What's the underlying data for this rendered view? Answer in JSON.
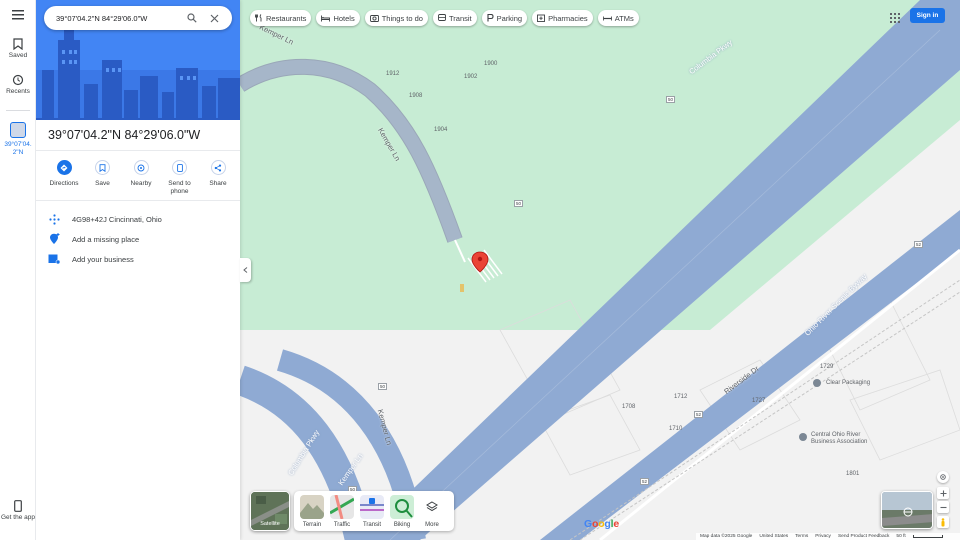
{
  "rail": {
    "saved_label": "Saved",
    "recents_label": "Recents",
    "recent_item_label": "39°07'04.\n2\"N",
    "get_app_label": "Get the app"
  },
  "search": {
    "value": "39°07'04.2\"N 84°29'06.0\"W"
  },
  "chips": [
    {
      "label": "Restaurants",
      "icon": "fork-knife-icon"
    },
    {
      "label": "Hotels",
      "icon": "bed-icon"
    },
    {
      "label": "Things to do",
      "icon": "camera-icon"
    },
    {
      "label": "Transit",
      "icon": "train-icon"
    },
    {
      "label": "Parking",
      "icon": "parking-icon"
    },
    {
      "label": "Pharmacies",
      "icon": "pharmacy-icon"
    },
    {
      "label": "ATMs",
      "icon": "atm-icon"
    }
  ],
  "header": {
    "sign_in_label": "Sign in"
  },
  "place": {
    "title": "39°07'04.2\"N 84°29'06.0\"W",
    "actions": [
      {
        "label": "Directions",
        "icon": "directions-icon"
      },
      {
        "label": "Save",
        "icon": "bookmark-icon"
      },
      {
        "label": "Nearby",
        "icon": "nearby-icon"
      },
      {
        "label": "Send to phone",
        "icon": "send-to-phone-icon"
      },
      {
        "label": "Share",
        "icon": "share-icon"
      }
    ],
    "plus_code": "4G98+42J Cincinnati, Ohio",
    "add_missing_place": "Add a missing place",
    "add_business": "Add your business"
  },
  "map": {
    "roads": {
      "columbia_pkwy_top": "Columbia Pkwy",
      "columbia_pkwy_bottom": "Columbia Pkwy",
      "kemper_ln_top": "Kemper Ln",
      "kemper_ln_mid": "Kemper Ln",
      "kemper_ln_bottom": "Kemper Ln",
      "kemper_ln_lower": "Kemper Ln",
      "ohio_river_byway": "Ohio River Scenic Byway",
      "riverside_dr": "Riverside Dr"
    },
    "route_shields": [
      "50",
      "50",
      "50",
      "50",
      "52",
      "52",
      "52"
    ],
    "address_numbers": [
      "1912",
      "1902",
      "1900",
      "1908",
      "1904",
      "1729",
      "1727",
      "1708",
      "1712",
      "1710",
      "1801"
    ],
    "pois": [
      {
        "label": "Clear Packaging",
        "color": "#7b8794"
      },
      {
        "label": "Central Ohio River\nBusiness Association",
        "color": "#7b8794"
      }
    ],
    "marker_color": "#ea4335"
  },
  "layers": {
    "satellite_label": "Satellite",
    "items": [
      "Terrain",
      "Traffic",
      "Transit",
      "Biking",
      "More"
    ]
  },
  "footer": {
    "map_data": "Map data ©2025 Google",
    "country": "United States",
    "terms": "Terms",
    "privacy": "Privacy",
    "feedback": "Send Product Feedback",
    "scale": "50 ft"
  },
  "colors": {
    "accent": "#1a73e8",
    "road_major": "#8faad3",
    "park": "#c7ecd4",
    "map_bg": "#f2f2f2"
  }
}
